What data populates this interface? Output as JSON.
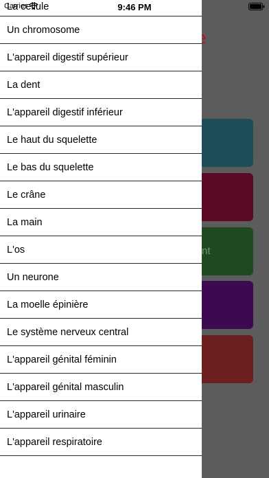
{
  "status_bar": {
    "carrier": "Carrier",
    "time": "9:46 PM"
  },
  "background": {
    "title_fragment": "e",
    "tile_text_fragment": "nt",
    "tile_colors": [
      "#1f4d57",
      "#5a0a25",
      "#1f4a1f",
      "#3d0a52",
      "#6b1f1f"
    ]
  },
  "menu": {
    "items": [
      {
        "label": "La cellule"
      },
      {
        "label": "Un chromosome"
      },
      {
        "label": "L'appareil digestif supérieur"
      },
      {
        "label": "La dent"
      },
      {
        "label": "L'appareil digestif inférieur"
      },
      {
        "label": "Le haut du squelette"
      },
      {
        "label": "Le bas du squelette"
      },
      {
        "label": "Le crâne"
      },
      {
        "label": "La main"
      },
      {
        "label": "L'os"
      },
      {
        "label": "Un neurone"
      },
      {
        "label": "La moelle épinière"
      },
      {
        "label": "Le système nerveux central"
      },
      {
        "label": "L'appareil génital féminin"
      },
      {
        "label": "L'appareil génital masculin"
      },
      {
        "label": "L'appareil urinaire"
      },
      {
        "label": "L'appareil respiratoire"
      }
    ]
  }
}
